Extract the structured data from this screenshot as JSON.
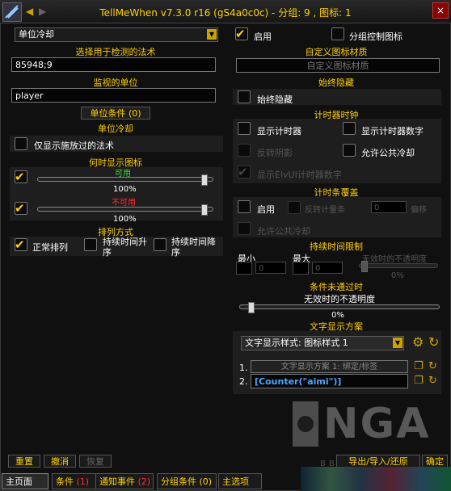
{
  "window": {
    "title": "TellMeWhen v7.3.0 r16 (gS4a0c0c) - 分组: 9 , 图标: 1",
    "close_label": "×"
  },
  "left": {
    "type_dropdown": "单位冷却",
    "spell_header": "选择用于检测的法术",
    "spell_value": "85948;9",
    "unit_header": "监视的单位",
    "unit_value": "player",
    "unit_conditions_button": "单位条件 (0)",
    "cooldown_header": "单位冷却",
    "only_cast_label": "仅显示施放过的法术",
    "when_header": "何时显示图标",
    "usable_label": "可用",
    "usable_pct": "100%",
    "unusable_label": "不可用",
    "unusable_pct": "100%",
    "sort_header": "排列方式",
    "sort_normal": "正常排列",
    "sort_asc": "持续时间升序",
    "sort_desc": "持续时间降序"
  },
  "right": {
    "enable_label": "启用",
    "group_ctrl_label": "分组控制图标",
    "custom_tex_header": "自定义图标材质",
    "custom_tex_value": "自定义图标材质",
    "always_hide_header": "始终隐藏",
    "always_hide_label": "始终隐藏",
    "timer_header": "计时器时钟",
    "show_timer": "显示计时器",
    "show_timer_text": "显示计时器数字",
    "reverse_shadow": "反转阴影",
    "allow_gcd": "允许公共冷却",
    "show_elvui": "显示ElvUI计时器数字",
    "bar_header": "计时条覆盖",
    "bar_enable": "启用",
    "bar_reverse": "反转计量条",
    "bar_value": "0",
    "bar_unit": "偏移",
    "bar_allow_gcd": "允许公共冷却",
    "duration_header": "持续时间限制",
    "dur_min": "最小",
    "dur_max": "最大",
    "dur_min_value": "0",
    "dur_max_value": "0",
    "dur_opacity_label": "无效时的不透明度",
    "dur_opacity_pct": "0%",
    "cond_header": "条件未通过时",
    "cond_opacity_label": "无效时的不透明度",
    "cond_opacity_pct": "0%",
    "text_header": "文字显示方案",
    "text_style_dropdown": "文字显示样式: 图标样式 1",
    "text_row1_num": "1.",
    "text_row1_value": "文字显示方案 1: 绑定/标签",
    "text_row2_num": "2.",
    "text_row2_value": "[Counter(\"aimi\")]"
  },
  "bottom": {
    "reset": "重置",
    "undo": "撤消",
    "redo": "恢复",
    "import_export": "导出/导入/还原",
    "ok": "确定"
  },
  "tabs": [
    {
      "label": "主页面"
    },
    {
      "label": "条件",
      "count": "(1)"
    },
    {
      "label": "通知事件",
      "count": "(2)"
    },
    {
      "label": "分组条件",
      "count": "(0)"
    },
    {
      "label": "主选项"
    }
  ],
  "watermark": "NGA",
  "watermark_url": "BBS.NGA.CN",
  "colors": {
    "accent": "#ffd100",
    "red": "#ff3030",
    "green": "#33dd33"
  }
}
